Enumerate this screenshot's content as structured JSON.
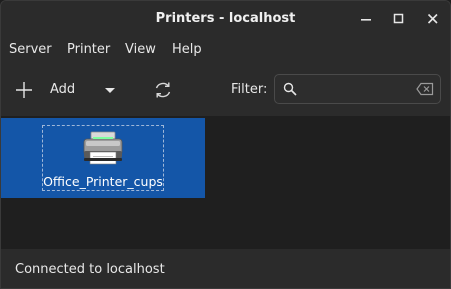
{
  "window": {
    "title": "Printers - localhost"
  },
  "menu": {
    "server": "Server",
    "printer": "Printer",
    "view": "View",
    "help": "Help"
  },
  "toolbar": {
    "add_label": "Add",
    "filter_label": "Filter:",
    "filter_value": "",
    "filter_placeholder": ""
  },
  "printers": [
    {
      "name": "Office_Printer_cups"
    }
  ],
  "status": {
    "text": "Connected to localhost"
  },
  "colors": {
    "background": "#2b2b2b",
    "content_background": "#1f1f1f",
    "selection": "#1456a8",
    "text": "#e8e8e8"
  },
  "icons": {
    "minimize": "minimize-icon",
    "maximize": "maximize-icon",
    "close": "close-icon",
    "add": "plus-icon",
    "dropdown": "chevron-down-icon",
    "refresh": "refresh-icon",
    "search": "search-icon",
    "clear": "clear-text-icon",
    "printer": "printer-icon"
  }
}
